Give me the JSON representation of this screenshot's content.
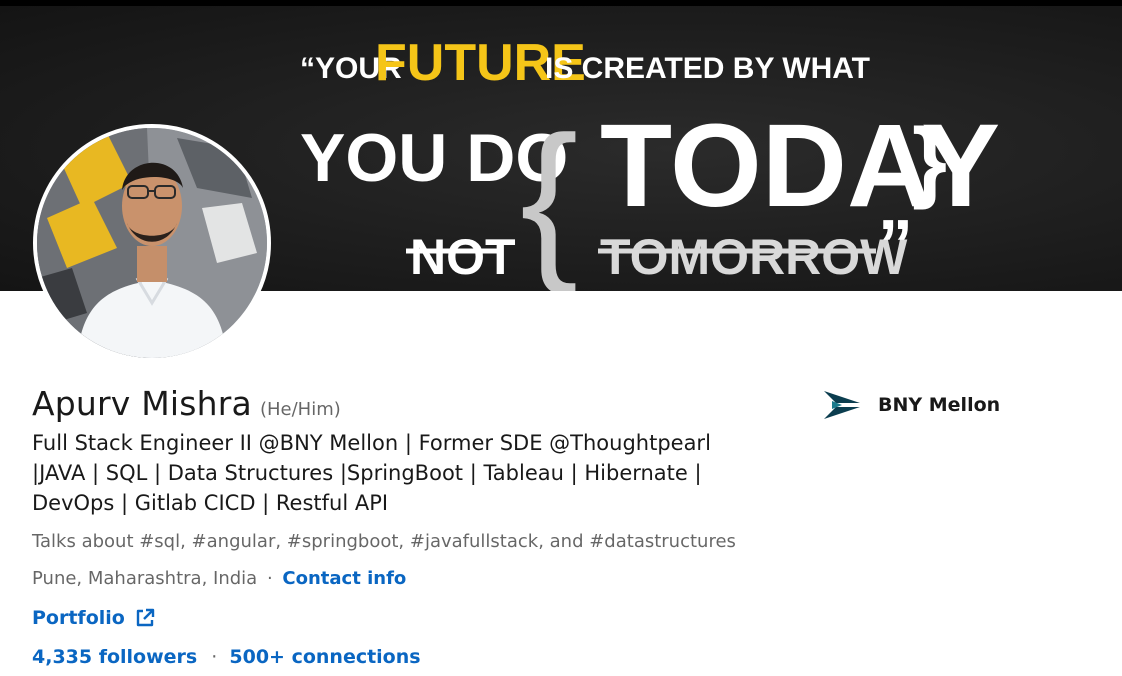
{
  "banner": {
    "line1_a": "“YOUR",
    "line1_b": "FUTURE",
    "line1_c": "IS CREATED BY WHAT",
    "line2_a": "YOU DO",
    "brace_open": "{",
    "line2_b": "TODAY",
    "brace_close": "}",
    "line3_a": "NOT",
    "line3_b": "TOMORROW",
    "line3_c": "”",
    "colors": {
      "accent": "#f5c518",
      "text": "#ffffff",
      "muted": "#d9d9d9",
      "brace": "#c8c8c8"
    }
  },
  "profile": {
    "name": "Apurv Mishra",
    "pronouns": "(He/Him)",
    "headline": "Full Stack Engineer II @BNY Mellon | Former SDE @Thoughtpearl |JAVA | SQL | Data Structures |SpringBoot | Tableau | Hibernate | DevOps | Gitlab CICD | Restful API",
    "talks_about": "Talks about #sql, #angular, #springboot, #javafullstack, and #datastructures",
    "location": "Pune, Maharashtra, India",
    "separator": "·",
    "contact_info": "Contact info",
    "portfolio": "Portfolio",
    "followers": "4,335 followers",
    "connections_sep": "·",
    "connections": "500+ connections"
  },
  "company": {
    "name": "BNY Mellon",
    "logo_icon": "bny-mellon-logo-icon",
    "logo_color": "#0b3d4f"
  },
  "colors": {
    "link": "#0a66c2"
  }
}
